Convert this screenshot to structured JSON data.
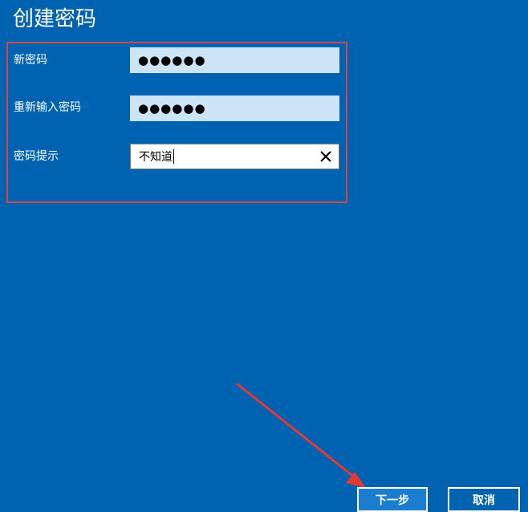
{
  "page": {
    "title": "创建密码"
  },
  "form": {
    "new_password": {
      "label": "新密码",
      "value": "●●●●●●"
    },
    "confirm_password": {
      "label": "重新输入密码",
      "value": "●●●●●●"
    },
    "password_hint": {
      "label": "密码提示",
      "value": "不知道"
    }
  },
  "buttons": {
    "next": "下一步",
    "cancel": "取消"
  },
  "colors": {
    "background": "#0063b1",
    "highlight_border": "#d4464c",
    "password_field_bg": "#cce4f7",
    "arrow": "#e53935"
  },
  "icons": {
    "clear": "close-icon"
  }
}
